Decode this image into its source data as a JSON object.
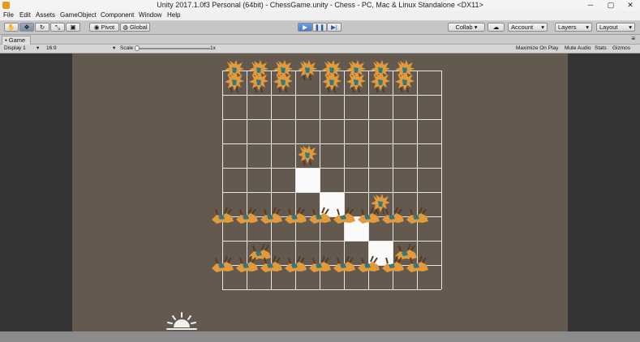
{
  "window": {
    "title": "Unity 2017.1.0f3 Personal (64bit) - ChessGame.unity - Chess - PC, Mac & Linux Standalone <DX11>",
    "min": "─",
    "max": "▢",
    "close": "✕"
  },
  "menu": [
    "File",
    "Edit",
    "Assets",
    "GameObject",
    "Component",
    "Window",
    "Help"
  ],
  "toolbar": {
    "pivot": "Pivot",
    "global": "Global",
    "collab": "Collab ▾",
    "account": "Account",
    "layers": "Layers",
    "layout": "Layout"
  },
  "game_tab": {
    "label": "Game",
    "display": "Display 1",
    "aspect": "16:9",
    "scale_label": "Scale",
    "scale_value": "1x",
    "maximize": "Maximize On Play",
    "mute": "Mute Audio",
    "stats": "Stats",
    "gizmos": "Gizmos"
  },
  "board": {
    "grid": 9,
    "colors": {
      "background": "#64594f",
      "gridline": "#e6e6e6",
      "highlight": "#fafafa",
      "piece_main": "#e29a3a",
      "piece_accent": "#2d7a83"
    },
    "highlights": [
      [
        5,
        3
      ],
      [
        6,
        4
      ],
      [
        7,
        5
      ],
      [
        8,
        6
      ]
    ],
    "enemy_pieces": [
      [
        0,
        0
      ],
      [
        0,
        1
      ],
      [
        0,
        2
      ],
      [
        0,
        3
      ],
      [
        0,
        4
      ],
      [
        0,
        5
      ],
      [
        0,
        6
      ],
      [
        0,
        7
      ],
      [
        1,
        0
      ],
      [
        1,
        1
      ],
      [
        1,
        2
      ],
      [
        1,
        4
      ],
      [
        1,
        5
      ],
      [
        1,
        6
      ],
      [
        1,
        7
      ],
      [
        4,
        3
      ],
      [
        6,
        6
      ]
    ],
    "player_pieces": [
      [
        7,
        0
      ],
      [
        7,
        1
      ],
      [
        7,
        2
      ],
      [
        7,
        3
      ],
      [
        7,
        4
      ],
      [
        7,
        5
      ],
      [
        7,
        6
      ],
      [
        7,
        7
      ],
      [
        7,
        8
      ],
      [
        8,
        1
      ],
      [
        8,
        7
      ],
      [
        9,
        0
      ],
      [
        9,
        1
      ],
      [
        9,
        2
      ],
      [
        9,
        3
      ],
      [
        9,
        4
      ],
      [
        9,
        5
      ],
      [
        9,
        6
      ],
      [
        9,
        7
      ],
      [
        9,
        8
      ]
    ]
  }
}
